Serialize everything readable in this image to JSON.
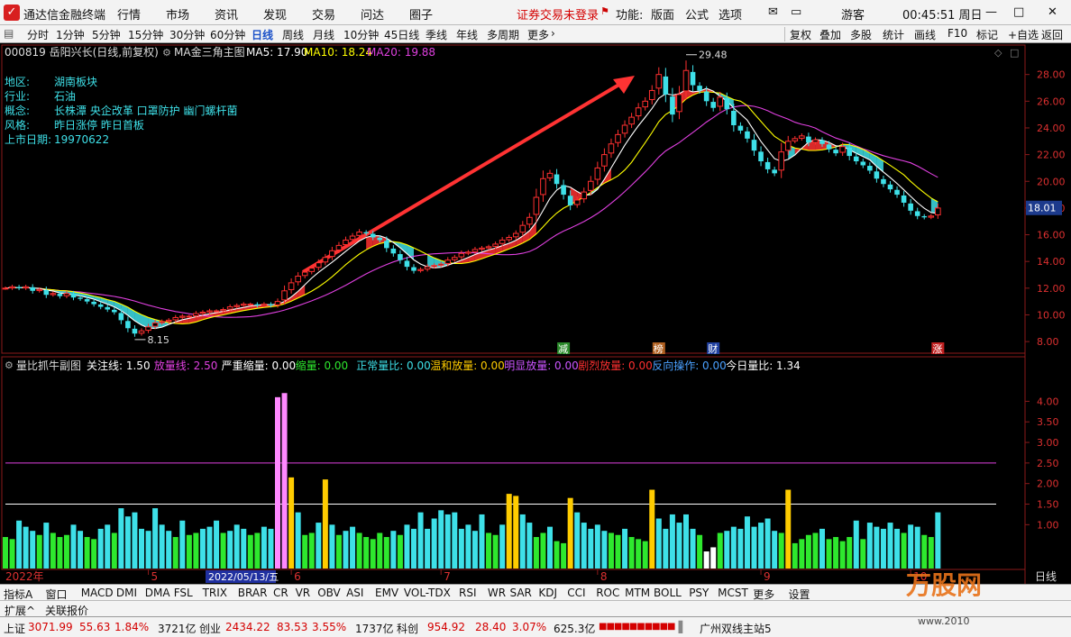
{
  "menubar": {
    "app_title": "通达信金融终端",
    "items": [
      "行情",
      "市场",
      "资讯",
      "发现",
      "交易",
      "问达",
      "圈子"
    ],
    "login_warning": "证券交易未登录",
    "fn_label": "功能:",
    "fn_items": [
      "版面",
      "公式",
      "选项"
    ],
    "user": "游客",
    "clock": "00:45:51 周日"
  },
  "periodbar": {
    "items": [
      "分时",
      "1分钟",
      "5分钟",
      "15分钟",
      "30分钟",
      "60分钟",
      "日线",
      "周线",
      "月线",
      "10分钟",
      "45日线",
      "季线",
      "年线",
      "多周期",
      "更多"
    ],
    "active": "日线",
    "right_items": [
      "复权",
      "叠加",
      "多股",
      "统计",
      "画线",
      "F10",
      "标记",
      "+自选",
      "返回"
    ]
  },
  "main_header": {
    "stock": "000819 岳阳兴长(日线,前复权)",
    "indicator": "MA金三角主图",
    "ma5": "MA5: 17.90",
    "ma10": "MA10: 18.24",
    "ma20": "MA20: 19.88"
  },
  "info_panel": [
    {
      "label": "地区:",
      "value": "湖南板块"
    },
    {
      "label": "行业:",
      "value": "石油"
    },
    {
      "label": "概念:",
      "value": "长株潭 央企改革 口罩防护 幽门螺杆菌"
    },
    {
      "label": "风格:",
      "value": "昨日涨停 昨日首板"
    },
    {
      "label": "上市日期:",
      "value": "19970622"
    }
  ],
  "sub_header": {
    "name": "量比抓牛副图",
    "items": [
      {
        "text": "关注线: 1.50",
        "color": "#ffffff"
      },
      {
        "text": "放量线: 2.50",
        "color": "#e040e0"
      },
      {
        "text": "严重缩量: 0.00",
        "color": "#ffffff"
      },
      {
        "text": "缩量: 0.00",
        "color": "#2ee82e"
      },
      {
        "text": "正常量比: 0.00",
        "color": "#3ee0e8"
      },
      {
        "text": "温和放量: 0.00",
        "color": "#ffcc00"
      },
      {
        "text": "明显放量: 0.00",
        "color": "#cc55ff"
      },
      {
        "text": "剧烈放量: 0.00",
        "color": "#ff3030"
      },
      {
        "text": "反向操作: 0.00",
        "color": "#4aa0ff"
      },
      {
        "text": "今日量比: 1.34",
        "color": "#ffffff"
      }
    ]
  },
  "markers": [
    {
      "text": "减",
      "idx": 82,
      "color": "#ffffff",
      "bg": "#2a8a2a"
    },
    {
      "text": "榜",
      "idx": 96,
      "color": "#ffffff",
      "bg": "#b06020"
    },
    {
      "text": "财",
      "idx": 104,
      "color": "#ffffff",
      "bg": "#2040a0"
    },
    {
      "text": "涨",
      "idx": 137,
      "color": "#ffffff",
      "bg": "#c02020"
    }
  ],
  "date_axis": {
    "year_label": "2022年",
    "cursor_label": "2022/05/13/五",
    "months": [
      {
        "label": "5",
        "idx": 21
      },
      {
        "label": "6",
        "idx": 42
      },
      {
        "label": "7",
        "idx": 64
      },
      {
        "label": "8",
        "idx": 87
      },
      {
        "label": "9",
        "idx": 111
      },
      {
        "label": "10",
        "idx": 133
      }
    ],
    "period_label": "日线"
  },
  "indbar": {
    "items": [
      "指标A",
      "窗口",
      "MACD",
      "DMI",
      "DMA",
      "FSL",
      "TRIX",
      "BRAR",
      "CR",
      "VR",
      "OBV",
      "ASI",
      "EMV",
      "VOL-TDX",
      "RSI",
      "WR",
      "SAR",
      "KDJ",
      "CCI",
      "ROC",
      "MTM",
      "BOLL",
      "PSY",
      "MCST",
      "更多",
      "设置"
    ]
  },
  "extbar": {
    "items": [
      "扩展^",
      "关联报价"
    ]
  },
  "statusbar": {
    "sh_label": "上证",
    "sh_val": "3071.99",
    "sh_chg": "55.63",
    "sh_pct": "1.84%",
    "sh_amt": "3721亿",
    "cy_label": "创业",
    "cy_val": "2434.22",
    "cy_chg": "83.53",
    "cy_pct": "3.55%",
    "cy_amt": "1737亿",
    "kc_label": "科创",
    "kc_val": "954.92",
    "kc_chg": "28.40",
    "kc_pct": "3.07%",
    "kc_amt": "625.3亿",
    "server": "广州双线主站5",
    "watermark": "万股网",
    "site": "www.2010"
  },
  "chart_data": [
    {
      "type": "candlestick",
      "title": "000819 岳阳兴长(日线,前复权)",
      "ylim": [
        7.4,
        29.8
      ],
      "yticks": [
        8,
        10,
        12,
        14,
        16,
        18,
        20,
        22,
        24,
        26,
        28
      ],
      "current_price": 18.01,
      "high_label": "29.48",
      "low_label": "8.15",
      "series": [
        {
          "name": "MA5",
          "color": "#ffffff"
        },
        {
          "name": "MA10",
          "color": "#ffff00"
        },
        {
          "name": "MA20",
          "color": "#e040e0"
        }
      ],
      "close": [
        12.0,
        12.1,
        12.0,
        12.1,
        11.8,
        11.9,
        11.5,
        11.6,
        11.4,
        11.6,
        11.3,
        11.2,
        11.0,
        10.8,
        10.6,
        10.4,
        10.2,
        9.6,
        9.0,
        8.6,
        8.8,
        9.1,
        9.4,
        9.5,
        9.6,
        9.8,
        9.9,
        9.9,
        10.1,
        10.2,
        10.3,
        10.3,
        10.4,
        10.6,
        10.7,
        10.8,
        10.8,
        10.7,
        10.8,
        10.7,
        11.0,
        11.8,
        12.4,
        12.9,
        13.2,
        13.5,
        13.9,
        14.3,
        14.8,
        15.2,
        15.6,
        15.9,
        16.2,
        16.1,
        15.8,
        15.6,
        15.0,
        14.6,
        14.1,
        13.6,
        13.3,
        13.4,
        13.6,
        13.7,
        13.8,
        14.1,
        14.3,
        14.6,
        14.7,
        14.9,
        15.0,
        15.1,
        15.3,
        15.6,
        15.8,
        16.1,
        16.7,
        17.3,
        18.8,
        20.2,
        20.6,
        19.8,
        19.0,
        18.2,
        18.6,
        19.2,
        20.0,
        21.0,
        22.0,
        22.8,
        23.5,
        24.2,
        24.8,
        25.5,
        26.0,
        26.8,
        28.0,
        26.5,
        25.0,
        26.5,
        28.3,
        27.2,
        26.8,
        26.0,
        25.5,
        26.3,
        25.4,
        24.2,
        23.8,
        23.2,
        22.3,
        21.5,
        20.9,
        20.6,
        22.2,
        23.0,
        23.2,
        23.4,
        22.9,
        23.1,
        22.8,
        22.4,
        22.1,
        22.6,
        21.9,
        21.5,
        21.2,
        20.8,
        20.2,
        19.8,
        19.4,
        19.0,
        18.4,
        17.8,
        17.4,
        17.3,
        17.4,
        18.0
      ],
      "sub_chart": {
        "type": "bar",
        "title": "量比抓牛副图",
        "ylim": [
          0,
          4.6
        ],
        "yticks": [
          1.0,
          1.5,
          2.0,
          2.5,
          3.0,
          3.5,
          4.0
        ],
        "focus_line": 1.5,
        "volume_line": 2.5,
        "values": [
          0.7,
          0.65,
          1.1,
          0.95,
          0.85,
          0.75,
          1.05,
          0.8,
          0.7,
          0.75,
          1.0,
          0.85,
          0.7,
          0.65,
          0.9,
          1.0,
          0.8,
          1.4,
          1.2,
          1.3,
          0.9,
          0.85,
          1.4,
          1.0,
          0.85,
          0.7,
          1.1,
          0.75,
          0.8,
          0.9,
          0.95,
          1.1,
          0.8,
          0.85,
          1.0,
          0.9,
          0.75,
          0.8,
          0.95,
          0.9,
          4.1,
          4.2,
          2.15,
          1.3,
          0.75,
          0.8,
          1.05,
          2.1,
          1.0,
          0.75,
          0.85,
          0.95,
          0.8,
          0.7,
          0.65,
          0.8,
          0.7,
          0.85,
          0.75,
          1.0,
          0.9,
          1.3,
          0.9,
          1.15,
          1.35,
          1.25,
          1.3,
          0.9,
          1.0,
          0.85,
          1.25,
          0.8,
          0.75,
          1.0,
          1.75,
          1.7,
          1.25,
          1.05,
          0.7,
          0.8,
          0.95,
          0.6,
          0.55,
          1.65,
          1.3,
          1.05,
          0.9,
          1.0,
          0.85,
          0.8,
          0.75,
          0.9,
          0.7,
          0.65,
          0.6,
          1.85,
          1.15,
          0.9,
          1.25,
          1.05,
          1.25,
          0.9,
          0.75,
          0.35,
          0.45,
          0.8,
          0.85,
          0.95,
          0.9,
          1.2,
          0.95,
          1.05,
          1.15,
          0.85,
          0.8,
          1.85,
          0.55,
          0.65,
          0.75,
          0.8,
          0.9,
          0.65,
          0.7,
          0.6,
          0.7,
          1.1,
          0.65,
          1.05,
          0.95,
          0.9,
          1.05,
          0.9,
          0.8,
          1.0,
          0.95,
          0.75,
          0.7,
          1.3
        ]
      }
    }
  ]
}
